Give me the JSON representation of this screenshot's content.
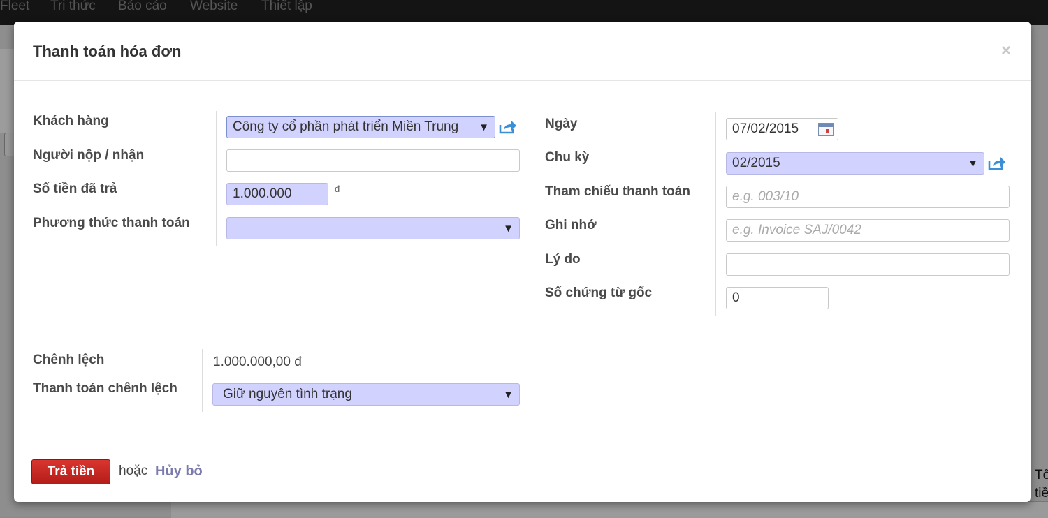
{
  "topbar": {
    "items": [
      "Fleet",
      "Tri thức",
      "Báo cáo",
      "Website",
      "Thiết lập"
    ]
  },
  "background": {
    "right_text_1": "Tổ",
    "right_text_2": "tiề"
  },
  "modal": {
    "title": "Thanh toán hóa đơn",
    "close": "×"
  },
  "form_left": {
    "customer": {
      "label": "Khách hàng",
      "value": "Công ty cổ phần phát triển Miền Trung"
    },
    "payer": {
      "label": "Người nộp / nhận",
      "value": ""
    },
    "amount": {
      "label": "Số tiền đã trả",
      "value": "1.000.000",
      "currency": "đ"
    },
    "payment_method": {
      "label": "Phương thức thanh toán",
      "value": ""
    }
  },
  "form_right": {
    "date": {
      "label": "Ngày",
      "value": "07/02/2015"
    },
    "period": {
      "label": "Chu kỳ",
      "value": "02/2015"
    },
    "payment_ref": {
      "label": "Tham chiếu thanh toán",
      "placeholder": "e.g. 003/10"
    },
    "memo": {
      "label": "Ghi nhớ",
      "placeholder": "e.g. Invoice SAJ/0042"
    },
    "reason": {
      "label": "Lý do",
      "value": ""
    },
    "source_docs": {
      "label": "Số chứng từ gốc",
      "value": "0"
    }
  },
  "difference": {
    "label": "Chênh lệch",
    "value": "1.000.000,00 đ",
    "handling_label": "Thanh toán chênh lệch",
    "handling_value": "Giữ nguyên tình trạng"
  },
  "footer": {
    "pay_label": "Trả tiền",
    "or_text": "hoặc",
    "cancel_label": "Hủy bỏ"
  },
  "colors": {
    "required_field": "#d2d2ff",
    "primary_button": "#c9271f",
    "link": "#7c7bad",
    "external_icon": "#3a8fd6"
  }
}
